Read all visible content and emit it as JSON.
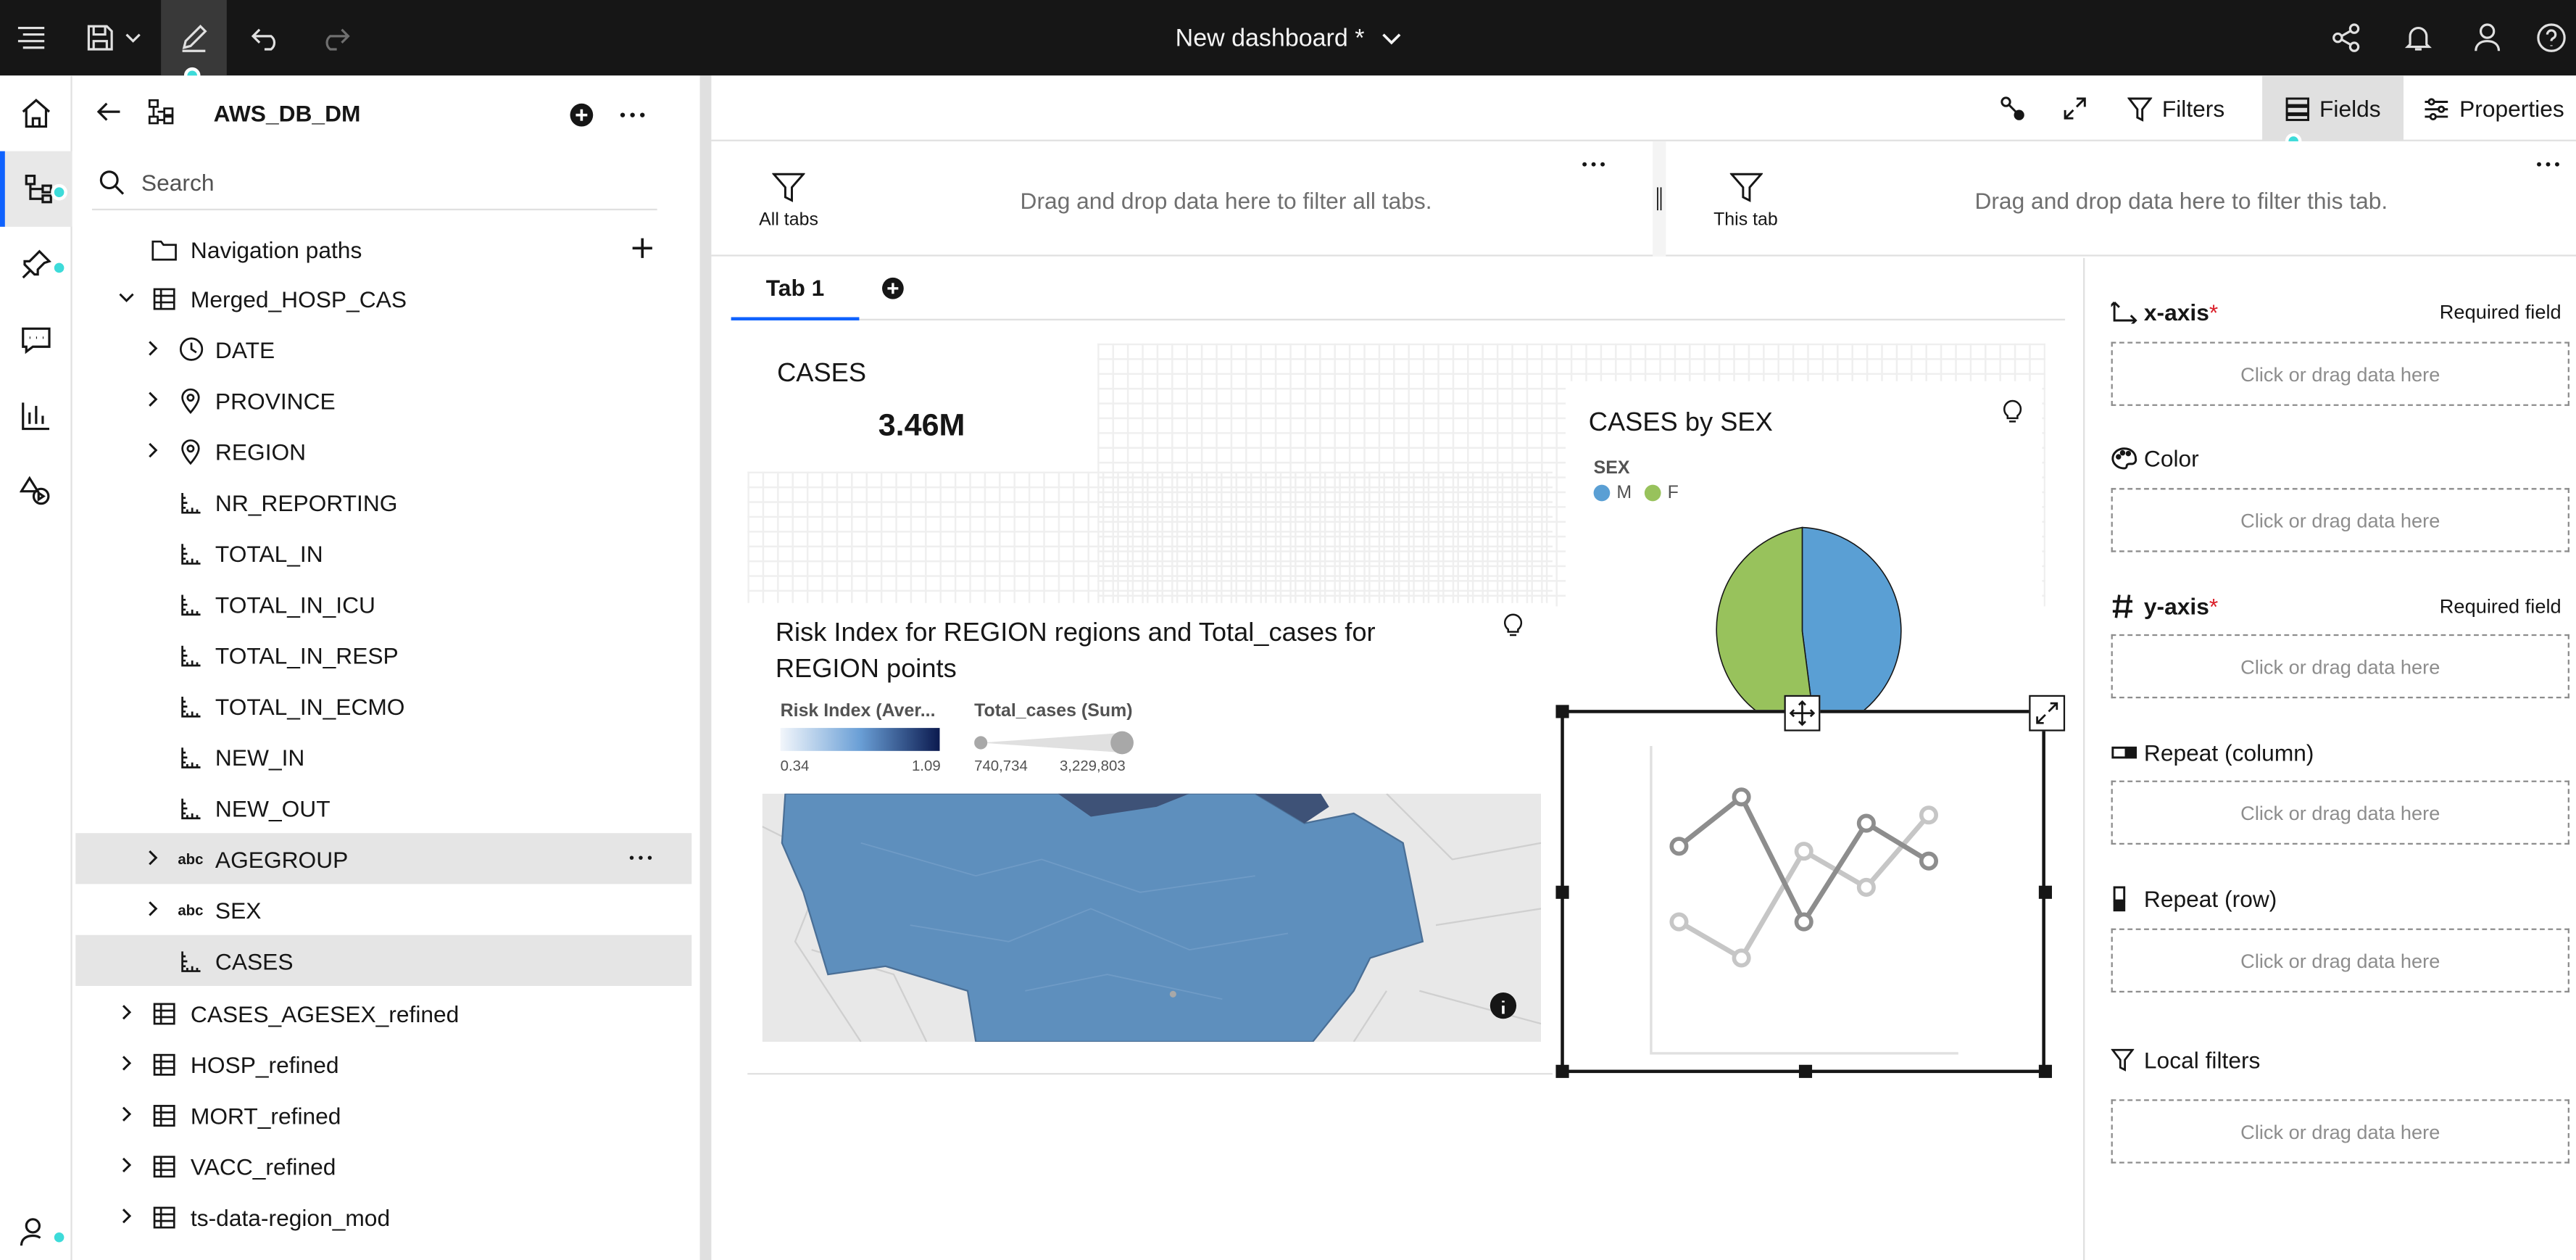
{
  "topbar": {
    "title": "New dashboard *"
  },
  "panel": {
    "title": "AWS_DB_DM",
    "search_placeholder": "Search",
    "tree": [
      {
        "label": "Navigation paths",
        "type": "folder"
      },
      {
        "label": "Merged_HOSP_CAS",
        "type": "table"
      },
      {
        "label": "DATE",
        "type": "time"
      },
      {
        "label": "PROVINCE",
        "type": "geo"
      },
      {
        "label": "REGION",
        "type": "geo"
      },
      {
        "label": "NR_REPORTING",
        "type": "measure"
      },
      {
        "label": "TOTAL_IN",
        "type": "measure"
      },
      {
        "label": "TOTAL_IN_ICU",
        "type": "measure"
      },
      {
        "label": "TOTAL_IN_RESP",
        "type": "measure"
      },
      {
        "label": "TOTAL_IN_ECMO",
        "type": "measure"
      },
      {
        "label": "NEW_IN",
        "type": "measure"
      },
      {
        "label": "NEW_OUT",
        "type": "measure"
      },
      {
        "label": "AGEGROUP",
        "type": "text",
        "abbr": "abc"
      },
      {
        "label": "SEX",
        "type": "text",
        "abbr": "abc"
      },
      {
        "label": "CASES",
        "type": "measure"
      },
      {
        "label": "CASES_AGESEX_refined",
        "type": "table"
      },
      {
        "label": "HOSP_refined",
        "type": "table"
      },
      {
        "label": "MORT_refined",
        "type": "table"
      },
      {
        "label": "VACC_refined",
        "type": "table"
      },
      {
        "label": "ts-data-region_mod",
        "type": "table"
      }
    ]
  },
  "toolbar": {
    "filters_label": "Filters",
    "fields_label": "Fields",
    "properties_label": "Properties"
  },
  "filterbar": {
    "all_tabs_label": "All tabs",
    "all_tabs_hint": "Drag and drop data here to filter all tabs.",
    "this_tab_label": "This tab",
    "this_tab_hint": "Drag and drop data here to filter this tab."
  },
  "tabs": [
    {
      "label": "Tab 1"
    }
  ],
  "kpi": {
    "title": "CASES",
    "value": "3.46M"
  },
  "pie": {
    "title": "CASES by SEX",
    "legend_title": "SEX",
    "legend": [
      {
        "label": "M",
        "color": "#5a9fd4"
      },
      {
        "label": "F",
        "color": "#98c25c"
      }
    ]
  },
  "map": {
    "title": "Risk Index for REGION regions and Total_cases for REGION points",
    "legend1_title": "Risk Index (Aver...",
    "legend1_min": "0.34",
    "legend1_max": "1.09",
    "legend2_title": "Total_cases (Sum)",
    "legend2_min": "740,734",
    "legend2_max": "3,229,803"
  },
  "fields": {
    "required_label": "Required field",
    "placeholder": "Click or drag data here",
    "slots": [
      {
        "label": "x-axis",
        "required": true
      },
      {
        "label": "Color",
        "required": false
      },
      {
        "label": "y-axis",
        "required": true
      },
      {
        "label": "Repeat (column)",
        "required": false
      },
      {
        "label": "Repeat (row)",
        "required": false
      },
      {
        "label": "Local filters",
        "required": false
      }
    ]
  },
  "colors": {
    "accent": "#0f62fe",
    "topbar": "#161616",
    "teal_dot": "#3ddbd9"
  }
}
